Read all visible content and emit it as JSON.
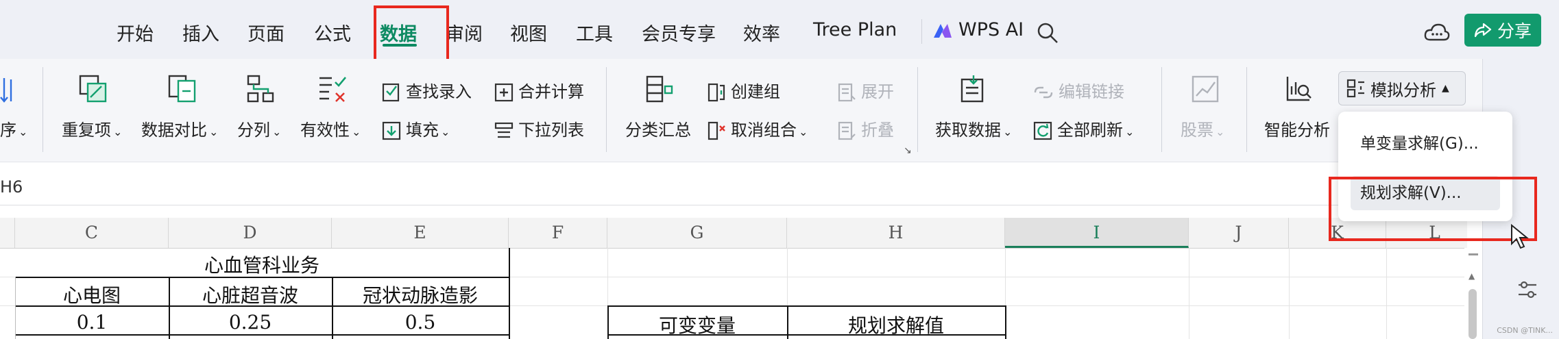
{
  "tabs": [
    {
      "label": "开始"
    },
    {
      "label": "插入"
    },
    {
      "label": "页面"
    },
    {
      "label": "公式"
    },
    {
      "label": "数据",
      "active": true
    },
    {
      "label": "审阅"
    },
    {
      "label": "视图"
    },
    {
      "label": "工具"
    },
    {
      "label": "会员专享"
    },
    {
      "label": "效率"
    },
    {
      "label": "Tree Plan"
    }
  ],
  "wps_ai": "WPS AI",
  "share": "分享",
  "ribbon": {
    "sort_partial": "序",
    "duplicates": "重复项",
    "compare": "数据对比",
    "split": "分列",
    "validity": "有效性",
    "find_entry": "查找录入",
    "fill": "填充",
    "consolidate": "合并计算",
    "dropdown_list": "下拉列表",
    "subtotal": "分类汇总",
    "create_group": "创建组",
    "ungroup": "取消组合",
    "expand": "展开",
    "collapse": "折叠",
    "get_data": "获取数据",
    "edit_links": "编辑链接",
    "refresh_all": "全部刷新",
    "stocks": "股票",
    "smart_analysis": "智能分析",
    "simulation": "模拟分析"
  },
  "dropdown": {
    "items": [
      "单变量求解(G)...",
      "规划求解(V)..."
    ]
  },
  "formula_bar": {
    "name_box": "H6"
  },
  "columns": [
    "C",
    "D",
    "E",
    "F",
    "G",
    "H",
    "I",
    "J",
    "K",
    "L"
  ],
  "selected_column": "I",
  "sheet": {
    "merged_title": "心血管科业务",
    "headers": [
      "心电图",
      "心脏超音波",
      "冠状动脉造影"
    ],
    "values": [
      "0.1",
      "0.25",
      "0.5"
    ],
    "table_headers": [
      "可变变量",
      "规划求解值"
    ]
  },
  "watermark": "CSDN @TINK..."
}
